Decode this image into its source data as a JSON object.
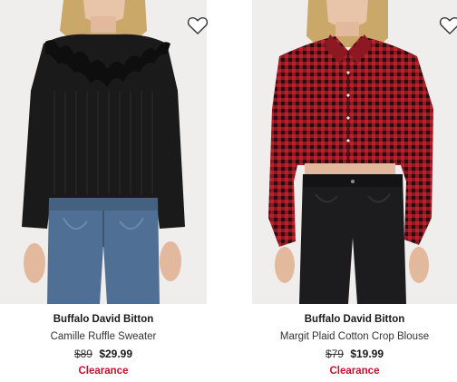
{
  "colors": {
    "sale_badge": "#c8102e",
    "photo_bg": "#f0eeec"
  },
  "products": [
    {
      "brand": "Buffalo David Bitton",
      "name": "Camille Ruffle Sweater",
      "original_price": "$89",
      "sale_price": "$29.99",
      "badge": "Clearance",
      "image_icon": "black-ruffle-sweater-photo",
      "wishlist_icon": "heart-outline-icon"
    },
    {
      "brand": "Buffalo David Bitton",
      "name": "Margit Plaid Cotton Crop Blouse",
      "original_price": "$79",
      "sale_price": "$19.99",
      "badge": "Clearance",
      "image_icon": "red-plaid-crop-blouse-photo",
      "wishlist_icon": "heart-outline-icon"
    }
  ]
}
